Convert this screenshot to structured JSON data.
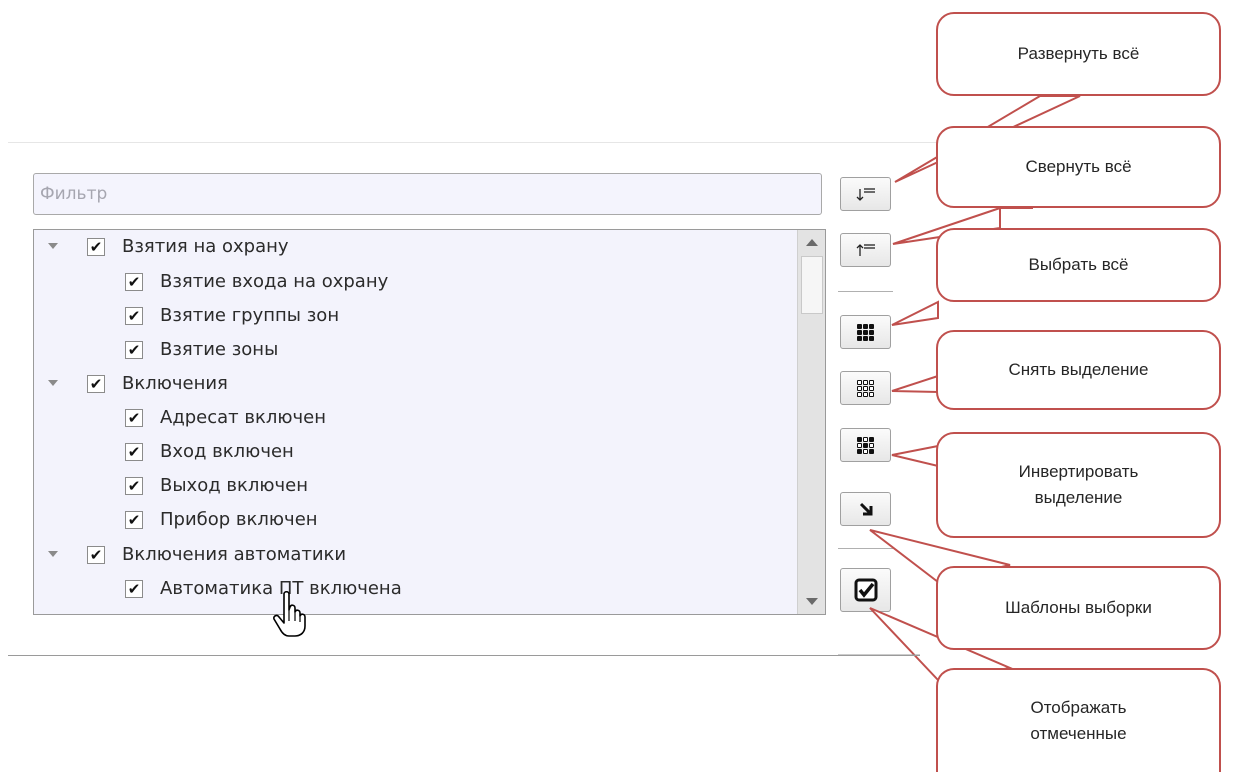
{
  "filter": {
    "placeholder": "Фильтр",
    "value": ""
  },
  "tree": {
    "items": [
      {
        "label": "Взятия на охрану",
        "checked": "✔",
        "expandable": true
      },
      {
        "label": "Взятие входа на охрану",
        "checked": "✔"
      },
      {
        "label": "Взятие группы зон",
        "checked": "✔"
      },
      {
        "label": "Взятие зоны",
        "checked": "✔"
      },
      {
        "label": "Включения",
        "checked": "✔",
        "expandable": true
      },
      {
        "label": "Адресат включен",
        "checked": "✔"
      },
      {
        "label": "Вход включен",
        "checked": "✔"
      },
      {
        "label": "Выход включен",
        "checked": "✔"
      },
      {
        "label": "Прибор включен",
        "checked": "✔"
      },
      {
        "label": "Включения автоматики",
        "checked": "✔",
        "expandable": true
      },
      {
        "label": "Автоматика ПТ включена",
        "checked": "✔"
      }
    ]
  },
  "toolbar": {
    "expand_all": {
      "icon": "expand-all-icon",
      "glyph": "↓═"
    },
    "collapse_all": {
      "icon": "collapse-all-icon",
      "glyph": "↑═"
    },
    "select_all": {
      "icon": "select-all-grid-icon"
    },
    "deselect": {
      "icon": "deselect-grid-icon"
    },
    "invert": {
      "icon": "invert-selection-grid-icon"
    },
    "templates": {
      "icon": "arrow-down-right-icon",
      "glyph": "↘"
    },
    "show_checked": {
      "icon": "checkbox-checked-icon",
      "glyph": "☑"
    }
  },
  "callouts": {
    "expand_all": "Развернуть всё",
    "collapse_all": "Свернуть всё",
    "select_all": "Выбрать всё",
    "deselect": "Снять выделение",
    "invert_line1": "Инвертировать",
    "invert_line2": "выделение",
    "templates": "Шаблоны выборки",
    "show_checked_line1": "Отображать",
    "show_checked_line2": "отмеченные"
  },
  "colors": {
    "callout_border": "#c0504d",
    "tree_background": "#f3f3fc",
    "filter_background": "#f4f4fd"
  }
}
